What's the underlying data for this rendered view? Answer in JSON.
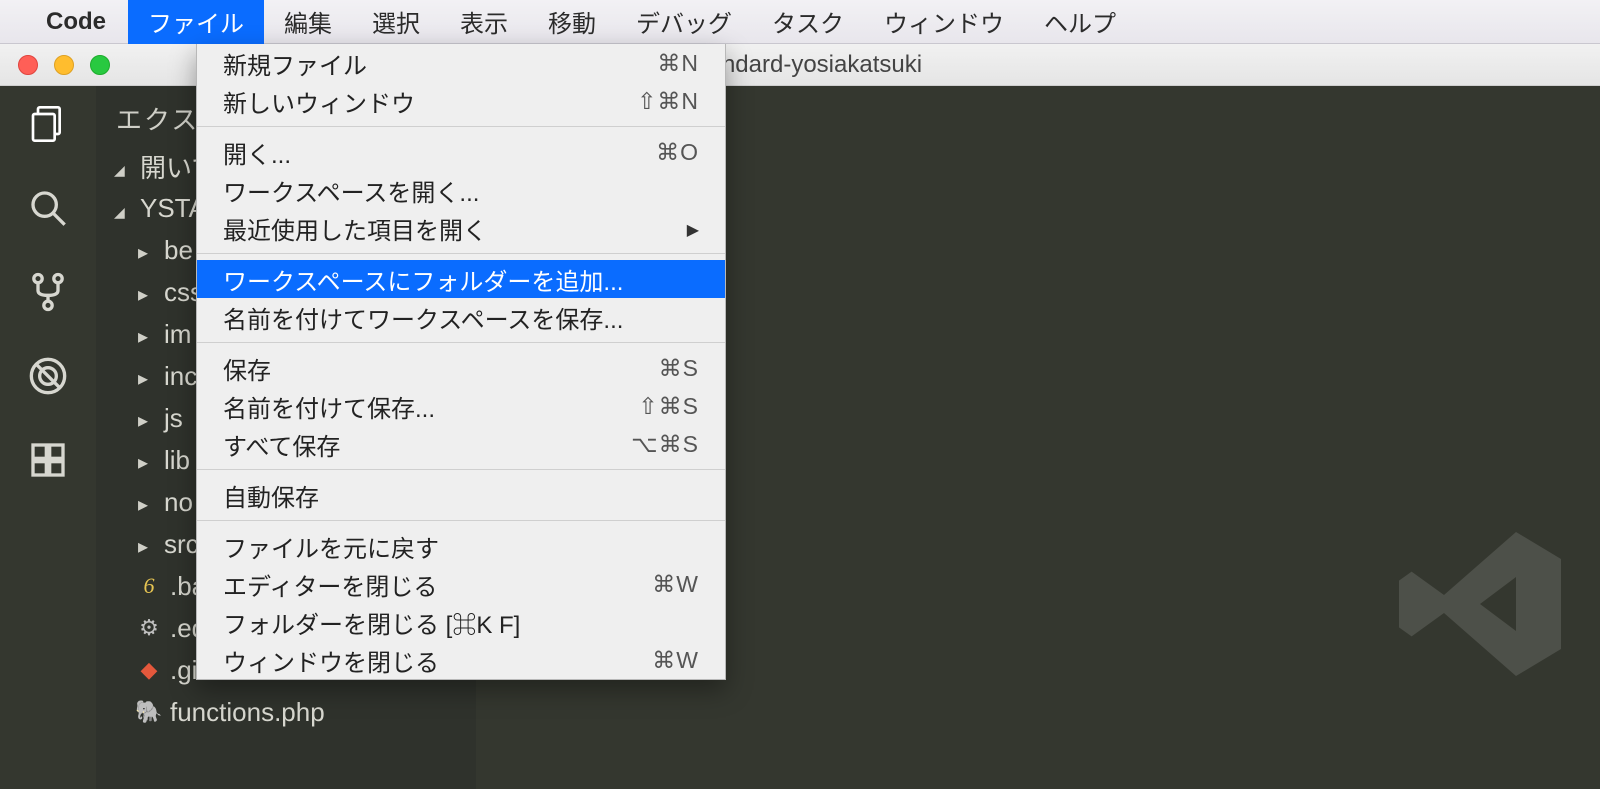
{
  "menubar": {
    "appname": "Code",
    "items": [
      "ファイル",
      "編集",
      "選択",
      "表示",
      "移動",
      "デバッグ",
      "タスク",
      "ウィンドウ",
      "ヘルプ"
    ],
    "selected_index": 0
  },
  "window": {
    "title": "ystandard-yosiakatsuki"
  },
  "sidebar": {
    "title": "エクスプローラー",
    "sections": [
      {
        "label": "開いているエディター",
        "expanded": true
      },
      {
        "label": "YSTANDARD-YOSIAKATSUKI",
        "expanded": true
      }
    ],
    "tree": [
      {
        "type": "folder",
        "label": "be"
      },
      {
        "type": "folder",
        "label": "css"
      },
      {
        "type": "folder",
        "label": "im"
      },
      {
        "type": "folder",
        "label": "inc"
      },
      {
        "type": "folder",
        "label": "js"
      },
      {
        "type": "folder",
        "label": "lib"
      },
      {
        "type": "folder",
        "label": "no"
      },
      {
        "type": "folder",
        "label": "src"
      },
      {
        "type": "file",
        "icon": "babel",
        "label": ".babelrc",
        "display": ".ba"
      },
      {
        "type": "file",
        "icon": "gear",
        "label": ".editorconfig",
        "display": ".ed"
      },
      {
        "type": "file",
        "icon": "git",
        "label": ".gitignore",
        "display": ".gi"
      },
      {
        "type": "file",
        "icon": "php",
        "label": "functions.php",
        "display": "functions.php"
      }
    ]
  },
  "dropdown": {
    "groups": [
      [
        {
          "label": "新規ファイル",
          "shortcut": "⌘N"
        },
        {
          "label": "新しいウィンドウ",
          "shortcut": "⇧⌘N"
        }
      ],
      [
        {
          "label": "開く...",
          "shortcut": "⌘O"
        },
        {
          "label": "ワークスペースを開く..."
        },
        {
          "label": "最近使用した項目を開く",
          "submenu": true
        }
      ],
      [
        {
          "label": "ワークスペースにフォルダーを追加...",
          "highlight": true
        },
        {
          "label": "名前を付けてワークスペースを保存..."
        }
      ],
      [
        {
          "label": "保存",
          "shortcut": "⌘S"
        },
        {
          "label": "名前を付けて保存...",
          "shortcut": "⇧⌘S"
        },
        {
          "label": "すべて保存",
          "shortcut": "⌥⌘S"
        }
      ],
      [
        {
          "label": "自動保存"
        }
      ],
      [
        {
          "label": "ファイルを元に戻す"
        },
        {
          "label": "エディターを閉じる",
          "shortcut": "⌘W"
        },
        {
          "label": "フォルダーを閉じる [⌘K F]"
        },
        {
          "label": "ウィンドウを閉じる",
          "shortcut": "⌘W"
        }
      ]
    ]
  }
}
